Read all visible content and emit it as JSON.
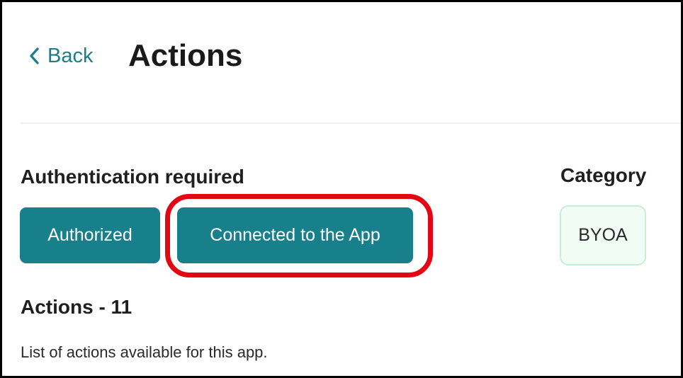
{
  "header": {
    "back_label": "Back",
    "title": "Actions"
  },
  "authentication": {
    "heading": "Authentication required",
    "authorized_label": "Authorized",
    "connected_label": "Connected to the App"
  },
  "category": {
    "heading": "Category",
    "value": "BYOA"
  },
  "actions": {
    "count_heading": "Actions - 11",
    "description": "List of actions available for this app."
  },
  "colors": {
    "accent": "#17808a",
    "link": "#1a7f86",
    "highlight": "#e30613",
    "chip_bg": "#f1fcf5",
    "chip_border": "#c6eed6"
  },
  "icons": {
    "back": "chevron-left-icon"
  }
}
